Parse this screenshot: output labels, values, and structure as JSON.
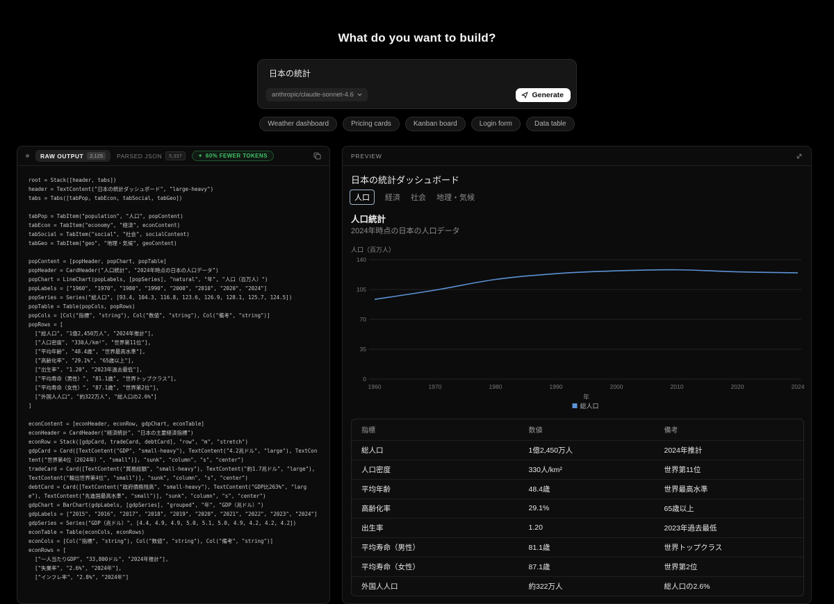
{
  "page": {
    "title": "What do you want to build?"
  },
  "colors": {
    "accent_blue": "#5b93d6",
    "badge_green": "#41c269"
  },
  "prompt_card": {
    "input_value": "日本の統計",
    "model_selector": "anthropic/claude-sonnet-4.6",
    "generate_label": "Generate"
  },
  "suggestion_chips": [
    "Weather dashboard",
    "Pricing cards",
    "Kanban board",
    "Login form",
    "Data table"
  ],
  "output_panel": {
    "tabs": [
      {
        "label": "RAW OUTPUT",
        "badge": "2,125",
        "active": true
      },
      {
        "label": "PARSED JSON",
        "badge": "5,337",
        "active": false
      }
    ],
    "savings_badge": "60% FEWER TOKENS",
    "sparkle_glyph": "✦",
    "code_lines": [
      "root = Stack([header, tabs])",
      "header = TextContent(\"日本の統計ダッシュボード\", \"large-heavy\")",
      "tabs = Tabs([tabPop, tabEcon, tabSocial, tabGeo])",
      "",
      "tabPop = TabItem(\"population\", \"人口\", popContent)",
      "tabEcon = TabItem(\"economy\", \"経済\", econContent)",
      "tabSocial = TabItem(\"social\", \"社会\", socialContent)",
      "tabGeo = TabItem(\"geo\", \"地理・気候\", geoContent)",
      "",
      "popContent = [popHeader, popChart, popTable]",
      "popHeader = CardHeader(\"人口統計\", \"2024年時点の日本の人口データ\")",
      "popChart = LineChart(popLabels, [popSeries], \"natural\", \"年\", \"人口（百万人）\")",
      "popLabels = [\"1960\", \"1970\", \"1980\", \"1990\", \"2000\", \"2010\", \"2020\", \"2024\"]",
      "popSeries = Series(\"総人口\", [93.4, 104.3, 116.8, 123.6, 126.9, 128.1, 125.7, 124.5])",
      "popTable = Table(popCols, popRows)",
      "popCols = [Col(\"指標\", \"string\"), Col(\"数値\", \"string\"), Col(\"備考\", \"string\")]",
      "popRows = [",
      "  [\"総人口\", \"1億2,450万人\", \"2024年推計\"],",
      "  [\"人口密度\", \"330人/km²\", \"世界第11位\"],",
      "  [\"平均年齢\", \"48.4歳\", \"世界最高水準\"],",
      "  [\"高齢化率\", \"29.1%\", \"65歳以上\"],",
      "  [\"出生率\", \"1.20\", \"2023年過去最低\"],",
      "  [\"平均寿命（男性）\", \"81.1歳\", \"世界トップクラス\"],",
      "  [\"平均寿命（女性）\", \"87.1歳\", \"世界第2位\"],",
      "  [\"外国人人口\", \"約322万人\", \"総人口の2.6%\"]",
      "]",
      "",
      "econContent = [econHeader, econRow, gdpChart, econTable]",
      "econHeader = CardHeader(\"経済統計\", \"日本の主要経済指標\")",
      "econRow = Stack([gdpCard, tradeCard, debtCard], \"row\", \"m\", \"stretch\")",
      "gdpCard = Card([TextContent(\"GDP\", \"small-heavy\"), TextContent(\"4.2兆ドル\", \"large\"), TextContent(\"世界第4位（2024年）\", \"small\")], \"sunk\", \"column\", \"s\", \"center\")",
      "tradeCard = Card([TextContent(\"貿易総額\", \"small-heavy\"), TextContent(\"約1.7兆ドル\", \"large\"), TextContent(\"輸出世界第4位\", \"small\")], \"sunk\", \"column\", \"s\", \"center\")",
      "debtCard = Card([TextContent(\"政府債務残高\", \"small-heavy\"), TextContent(\"GDP比263%\", \"large\"), TextContent(\"先進国最高水準\", \"small\")], \"sunk\", \"column\", \"s\", \"center\")",
      "gdpChart = BarChart(gdpLabels, [gdpSeries], \"grouped\", \"年\", \"GDP（兆ドル）\")",
      "gdpLabels = [\"2015\", \"2016\", \"2017\", \"2018\", \"2019\", \"2020\", \"2021\", \"2022\", \"2023\", \"2024\"]",
      "gdpSeries = Series(\"GDP（兆ドル）\", [4.4, 4.9, 4.9, 5.0, 5.1, 5.0, 4.9, 4.2, 4.2, 4.2])",
      "econTable = Table(econCols, econRows)",
      "econCols = [Col(\"指標\", \"string\"), Col(\"数値\", \"string\"), Col(\"備考\", \"string\")]",
      "econRows = [",
      "  [\"一人当たりGDP\", \"33,800ドル\", \"2024年推計\"],",
      "  [\"失業率\", \"2.6%\", \"2024年\"],",
      "  [\"インフレ率\", \"2.8%\", \"2024年\"]"
    ]
  },
  "preview_panel": {
    "header": "PREVIEW",
    "title": "日本の統計ダッシュボード",
    "tabs": [
      {
        "label": "人口",
        "active": true
      },
      {
        "label": "経済",
        "active": false
      },
      {
        "label": "社会",
        "active": false
      },
      {
        "label": "地理・気候",
        "active": false
      }
    ],
    "section": {
      "heading": "人口統計",
      "subheading": "2024年時点の日本の人口データ"
    },
    "chart_data": {
      "type": "line",
      "title": "人口統計",
      "subtitle": "2024年時点の日本の人口データ",
      "x": [
        "1960",
        "1970",
        "1980",
        "1990",
        "2000",
        "2010",
        "2020",
        "2024"
      ],
      "series": [
        {
          "name": "総人口",
          "values": [
            93.4,
            104.3,
            116.8,
            123.6,
            126.9,
            128.1,
            125.7,
            124.5
          ]
        }
      ],
      "xlabel": "年",
      "ylabel": "人口（百万人）",
      "ylim": [
        0,
        140
      ],
      "yticks": [
        0,
        35,
        70,
        105,
        140
      ],
      "grid": true,
      "legend_position": "bottom",
      "line_color": "#5b93d6",
      "smoothing": "natural"
    },
    "table": {
      "columns": [
        "指標",
        "数値",
        "備考"
      ],
      "rows": [
        [
          "総人口",
          "1億2,450万人",
          "2024年推計"
        ],
        [
          "人口密度",
          "330人/km²",
          "世界第11位"
        ],
        [
          "平均年齢",
          "48.4歳",
          "世界最高水準"
        ],
        [
          "高齢化率",
          "29.1%",
          "65歳以上"
        ],
        [
          "出生率",
          "1.20",
          "2023年過去最低"
        ],
        [
          "平均寿命（男性）",
          "81.1歳",
          "世界トップクラス"
        ],
        [
          "平均寿命（女性）",
          "87.1歳",
          "世界第2位"
        ],
        [
          "外国人人口",
          "約322万人",
          "総人口の2.6%"
        ]
      ]
    }
  }
}
